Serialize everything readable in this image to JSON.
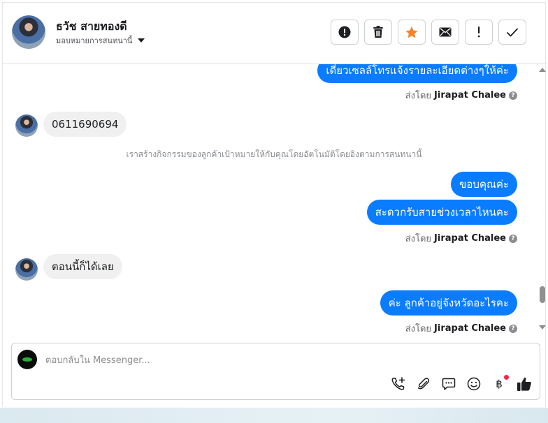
{
  "header": {
    "contact_name": "ธวัช สายทองดี",
    "assign_label": "มอบหมายการสนทนานี้",
    "actions": [
      {
        "name": "mark-spam",
        "icon": "exclamation-circle-icon"
      },
      {
        "name": "delete",
        "icon": "trash-icon"
      },
      {
        "name": "star",
        "icon": "star-icon",
        "color": "#f5832a"
      },
      {
        "name": "mark-unread",
        "icon": "envelope-icon"
      },
      {
        "name": "follow-up",
        "icon": "exclamation-icon"
      },
      {
        "name": "done",
        "icon": "checkmark-icon"
      }
    ]
  },
  "messages": [
    {
      "type": "outgoing",
      "text": "เดี๋ยวเซลล์โทรแจ้งรายละเอียดต่างๆให้ค่ะ"
    },
    {
      "type": "sent_by",
      "prefix": "ส่งโดย",
      "agent": "Jirapat Chalee"
    },
    {
      "type": "incoming",
      "text": "0611690694"
    },
    {
      "type": "system",
      "text": "เราสร้างกิจกรรมของลูกค้าเป้าหมายให้กับคุณโดยอัตโนมัติโดยอิงตามการสนทนานี้"
    },
    {
      "type": "outgoing",
      "text": "ขอบคุณค่ะ"
    },
    {
      "type": "outgoing",
      "text": "สะดวกรับสายช่วงเวลาไหนคะ"
    },
    {
      "type": "sent_by",
      "prefix": "ส่งโดย",
      "agent": "Jirapat Chalee"
    },
    {
      "type": "incoming",
      "text": "ตอนนี้ก็ได้เลย"
    },
    {
      "type": "outgoing",
      "text": "ค่ะ ลูกค้าอยู่จังหวัดอะไรคะ"
    },
    {
      "type": "sent_by",
      "prefix": "ส่งโดย",
      "agent": "Jirapat Chalee"
    }
  ],
  "composer": {
    "placeholder": "ตอบกลับใน Messenger...",
    "value": "",
    "tools": [
      "phone-plus-icon",
      "paperclip-icon",
      "chat-bubble-icon",
      "emoji-icon",
      "baht-icon",
      "thumbs-up-icon"
    ],
    "baht_symbol": "฿"
  },
  "colors": {
    "outgoing_bubble": "#0a7cff",
    "incoming_bubble": "#f0f0f0",
    "star": "#f5832a",
    "notification_dot": "#f02849"
  }
}
